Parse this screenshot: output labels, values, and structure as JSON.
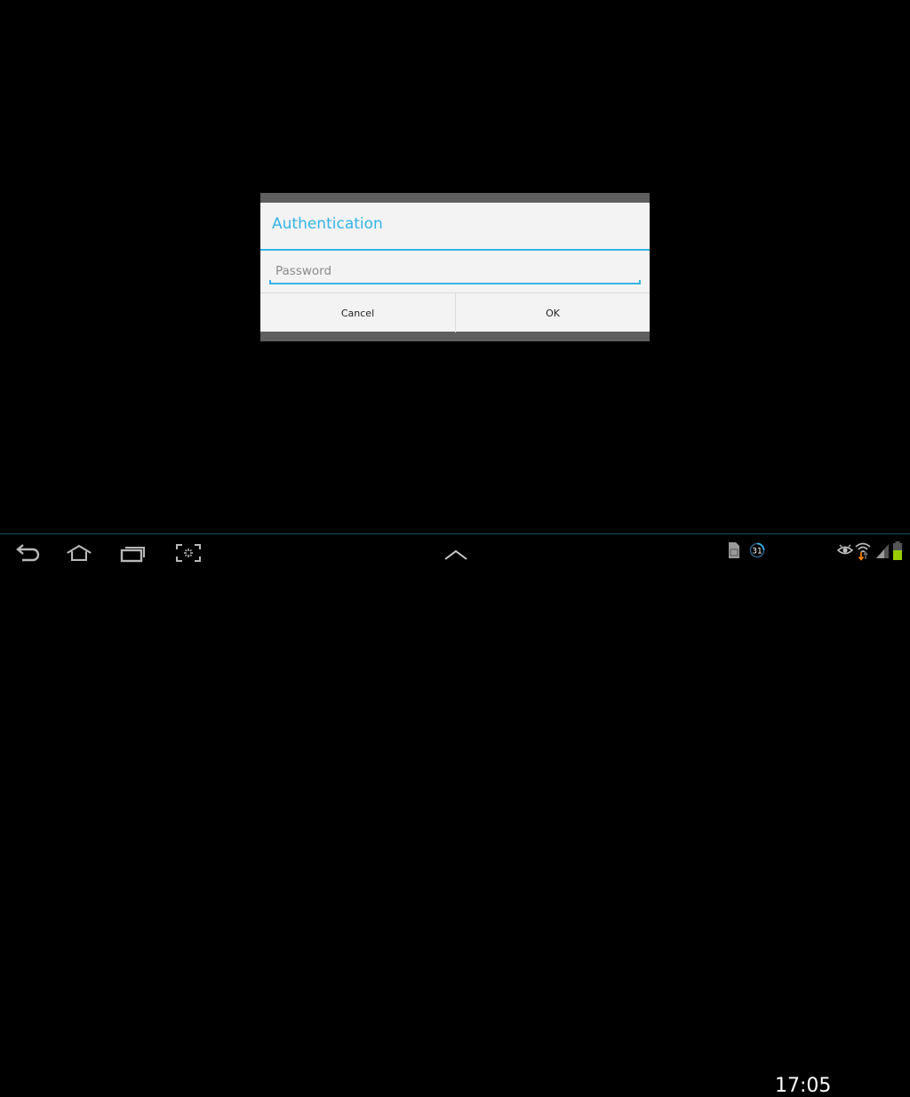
{
  "dialog": {
    "title": "Authentication",
    "password_field": {
      "value": "",
      "placeholder": "Password"
    },
    "buttons": {
      "cancel": "Cancel",
      "ok": "OK"
    },
    "accent_color": "#33b5e5"
  },
  "system_bar": {
    "nav_icons": [
      "back-icon",
      "home-icon",
      "recent-apps-icon",
      "screenshot-icon"
    ],
    "center_icon": "chevron-up-icon",
    "status_icons": [
      "sd-card-icon",
      "calendar-notification-icon",
      "eye-icon",
      "wifi-icon",
      "signal-icon",
      "battery-icon"
    ],
    "calendar_day": "31",
    "clock": "17:05",
    "battery_color": "#99cc00"
  }
}
